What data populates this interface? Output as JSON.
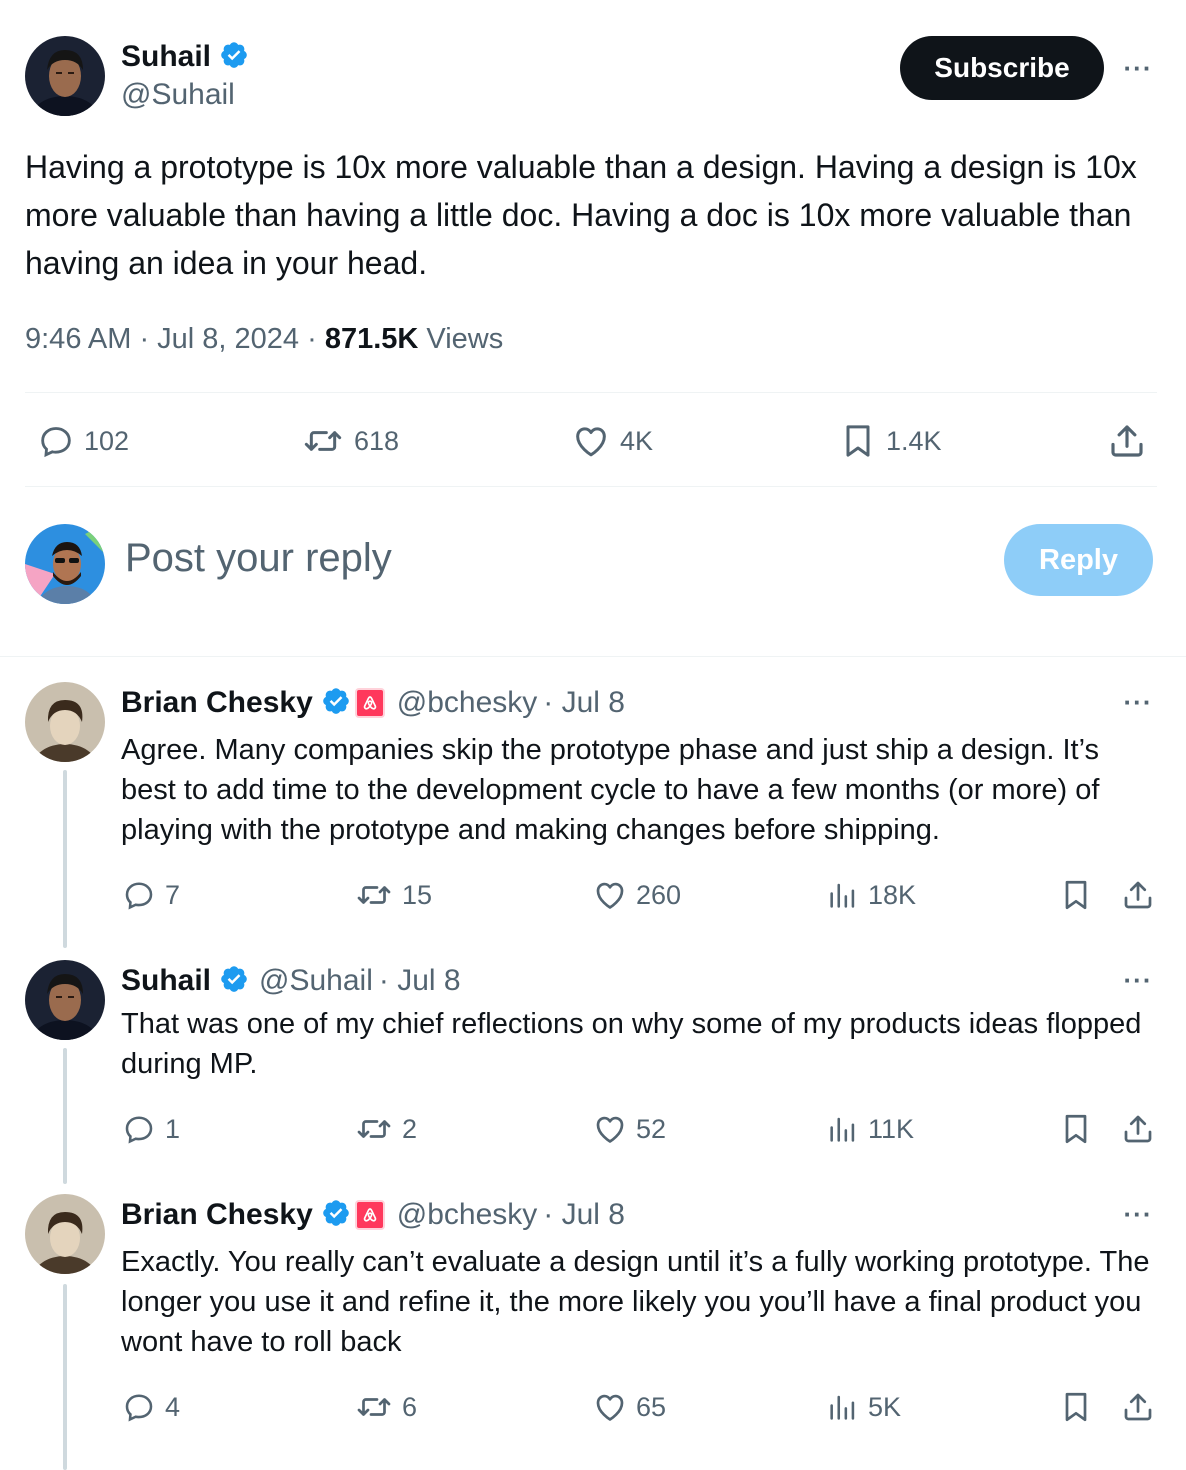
{
  "main_tweet": {
    "author_name": "Suhail",
    "author_handle": "@Suhail",
    "subscribe_label": "Subscribe",
    "more_label": "···",
    "text": "Having a prototype is 10x more valuable than a design. Having a design is 10x more valuable than having a little doc. Having a doc is 10x more valuable than having an idea in your head.",
    "time": "9:46 AM · Jul 8, 2024 · ",
    "views_count": "871.5K",
    "views_label": " Views",
    "stats": {
      "replies": "102",
      "reposts": "618",
      "likes": "4K",
      "bookmarks": "1.4K"
    }
  },
  "reply_box": {
    "placeholder": "Post your reply",
    "button_label": "Reply"
  },
  "replies": [
    {
      "author_name": "Brian Chesky",
      "author_handle": "@bchesky",
      "date": "· Jul 8",
      "text": "Agree. Many companies skip the prototype phase and just ship a design. It’s best to add time to the development cycle to have a few months (or more) of playing with the prototype and making changes before shipping.",
      "replies": "7",
      "reposts": "15",
      "likes": "260",
      "views": "18K"
    },
    {
      "author_name": "Suhail",
      "author_handle": "@Suhail",
      "date": "· Jul 8",
      "text": "That was one of my chief reflections on why some of my  products ideas flopped during MP.",
      "replies": "1",
      "reposts": "2",
      "likes": "52",
      "views": "11K"
    },
    {
      "author_name": "Brian Chesky",
      "author_handle": "@bchesky",
      "date": "· Jul 8",
      "text": "Exactly. You really can’t evaluate a design until it’s a fully working prototype. The longer you use it and refine it, the more likely you you’ll have a final product you wont have to roll back",
      "replies": "4",
      "reposts": "6",
      "likes": "65",
      "views": "5K"
    }
  ],
  "colors": {
    "text": "#0f1419",
    "secondary": "#536471",
    "verified": "#1d9bf0",
    "reply_button": "#8ecdf8",
    "airbnb": "#ff385c"
  }
}
